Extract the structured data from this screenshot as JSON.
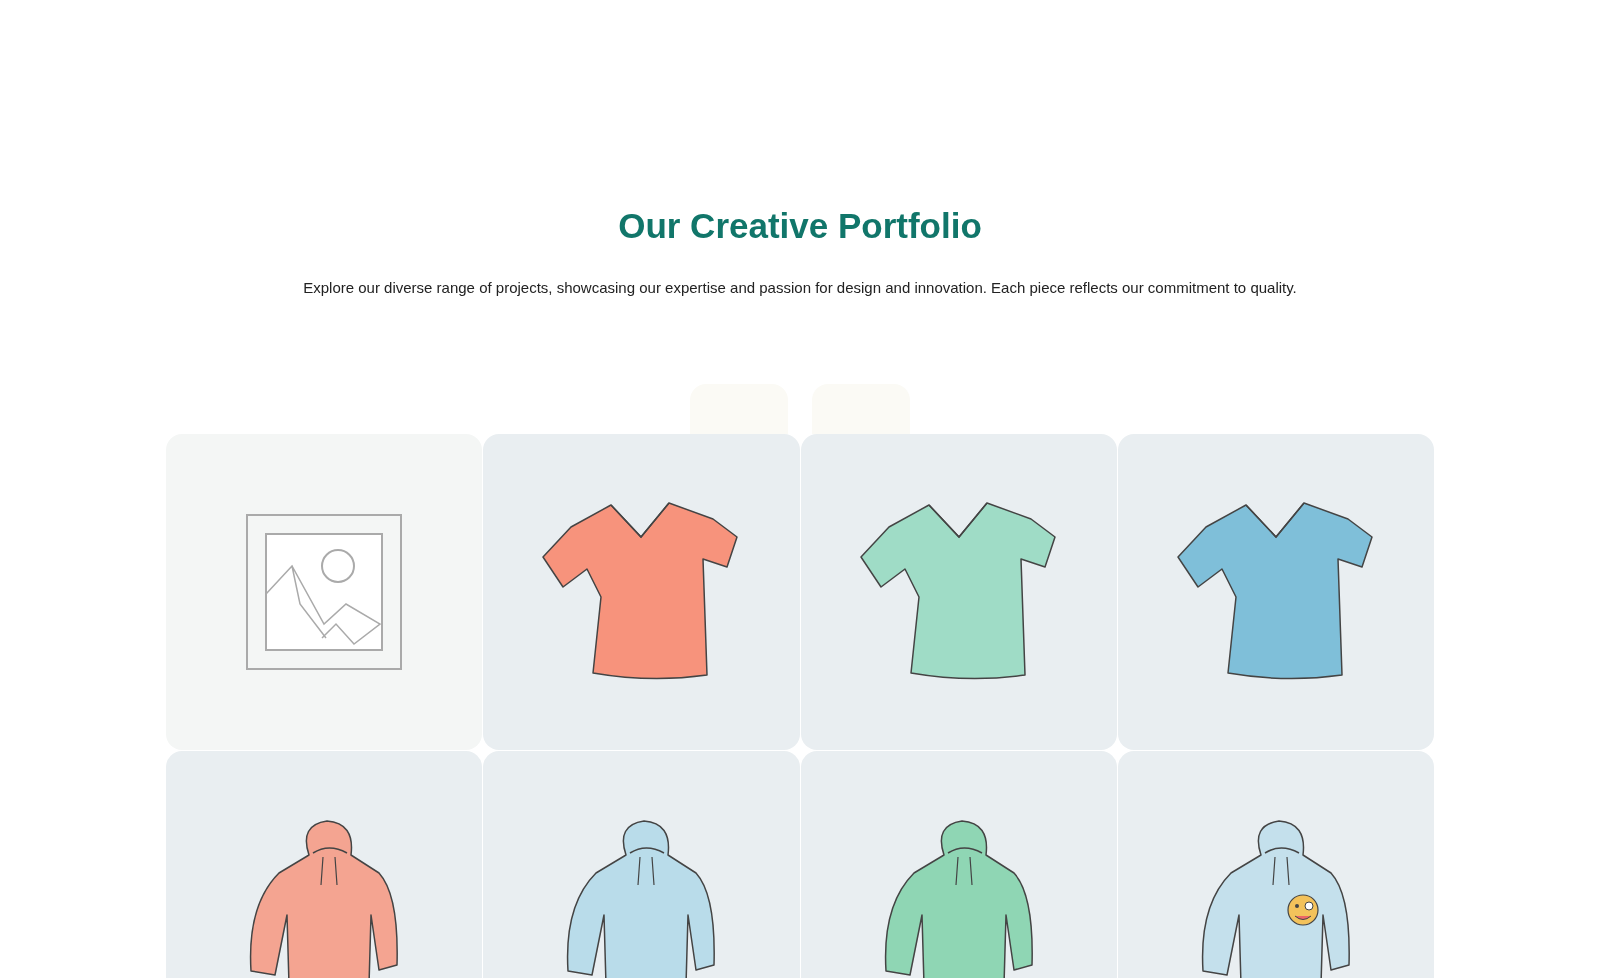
{
  "header": {
    "title": "Our Creative Portfolio",
    "subtitle": "Explore our diverse range of projects, showcasing our expertise and passion for design and innovation. Each piece reflects our commitment to quality."
  },
  "gallery": [
    {
      "kind": "placeholder"
    },
    {
      "kind": "tshirt",
      "color": "#f7937c"
    },
    {
      "kind": "tshirt",
      "color": "#9fdcc6"
    },
    {
      "kind": "tshirt",
      "color": "#7fbfd9"
    },
    {
      "kind": "hoodie",
      "color": "#f4a491"
    },
    {
      "kind": "hoodie",
      "color": "#b9dcea"
    },
    {
      "kind": "hoodie",
      "color": "#8fd6b4"
    },
    {
      "kind": "emoji_hoodie",
      "color": "#c4e0ec"
    }
  ]
}
